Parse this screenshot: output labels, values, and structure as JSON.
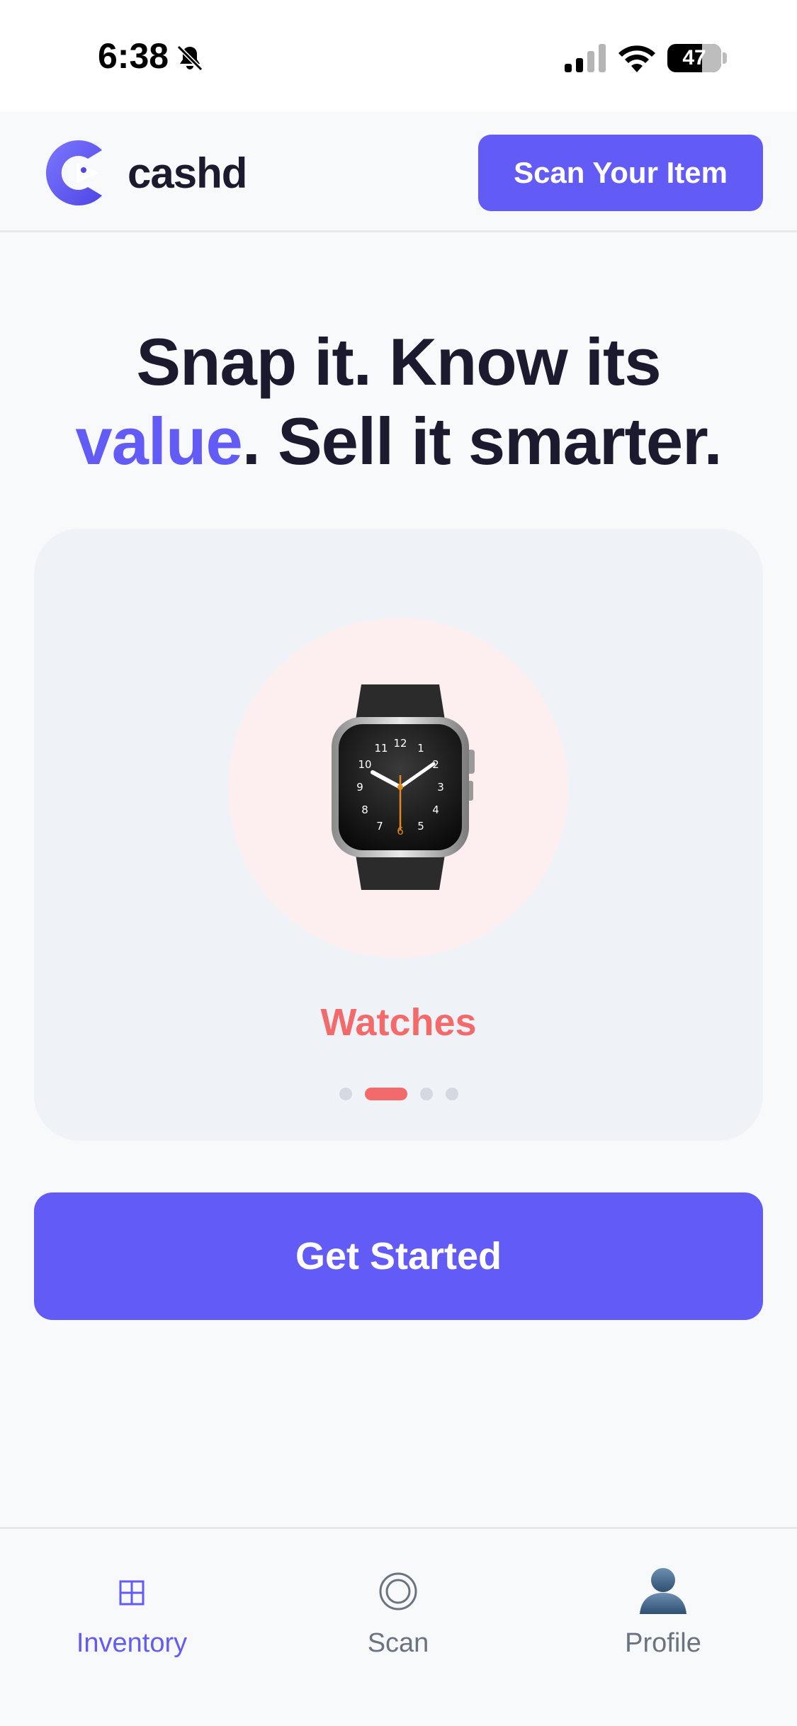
{
  "status_bar": {
    "time": "6:38",
    "battery": "47",
    "icons": [
      "bell-slash-icon",
      "signal-icon",
      "wifi-icon",
      "battery-icon"
    ]
  },
  "header": {
    "logo_text": "cashd",
    "scan_button_label": "Scan Your Item"
  },
  "hero": {
    "line1": "Snap it. Know its",
    "accent_word": "value",
    "line2_rest": ". Sell it smarter."
  },
  "carousel": {
    "current_category": "Watches",
    "active_index": 1,
    "total_slides": 4
  },
  "cta": {
    "label": "Get Started"
  },
  "bottom_nav": {
    "items": [
      {
        "label": "Inventory",
        "icon": "grid-icon",
        "active": true
      },
      {
        "label": "Scan",
        "icon": "scan-ring-icon",
        "active": false
      },
      {
        "label": "Profile",
        "icon": "person-icon",
        "active": false
      }
    ]
  },
  "colors": {
    "accent": "#625bf6",
    "category": "#f26a6a",
    "text_dark": "#1b1a2e",
    "card_bg": "#eff2f7",
    "circle_bg": "#fdeff0"
  }
}
